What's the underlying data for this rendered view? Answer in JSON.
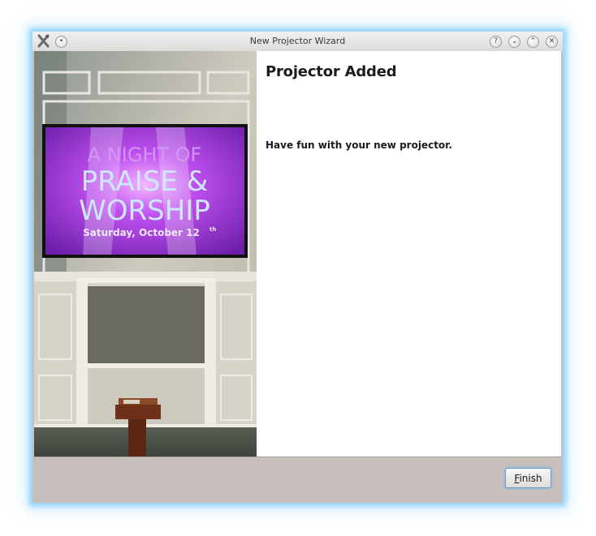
{
  "window": {
    "title": "New Projector Wizard",
    "buttons": {
      "menu": "•",
      "help": "?",
      "minimize": "⌄",
      "maximize": "⌃",
      "close": "✕"
    }
  },
  "photo": {
    "screen_line1": "A NIGHT OF",
    "screen_line2": "PRAISE &",
    "screen_line3": "WORSHIP",
    "screen_date": "Saturday, October 12",
    "screen_date_suffix": "th"
  },
  "page": {
    "heading": "Projector Added",
    "message": "Have fun with your new projector."
  },
  "footer": {
    "finish_mnemonic": "F",
    "finish_rest": "inish"
  },
  "colors": {
    "window_bg": "#c6bfbc",
    "focus_glow": "#78c8ff",
    "screen_purple": "#a13fd6"
  }
}
